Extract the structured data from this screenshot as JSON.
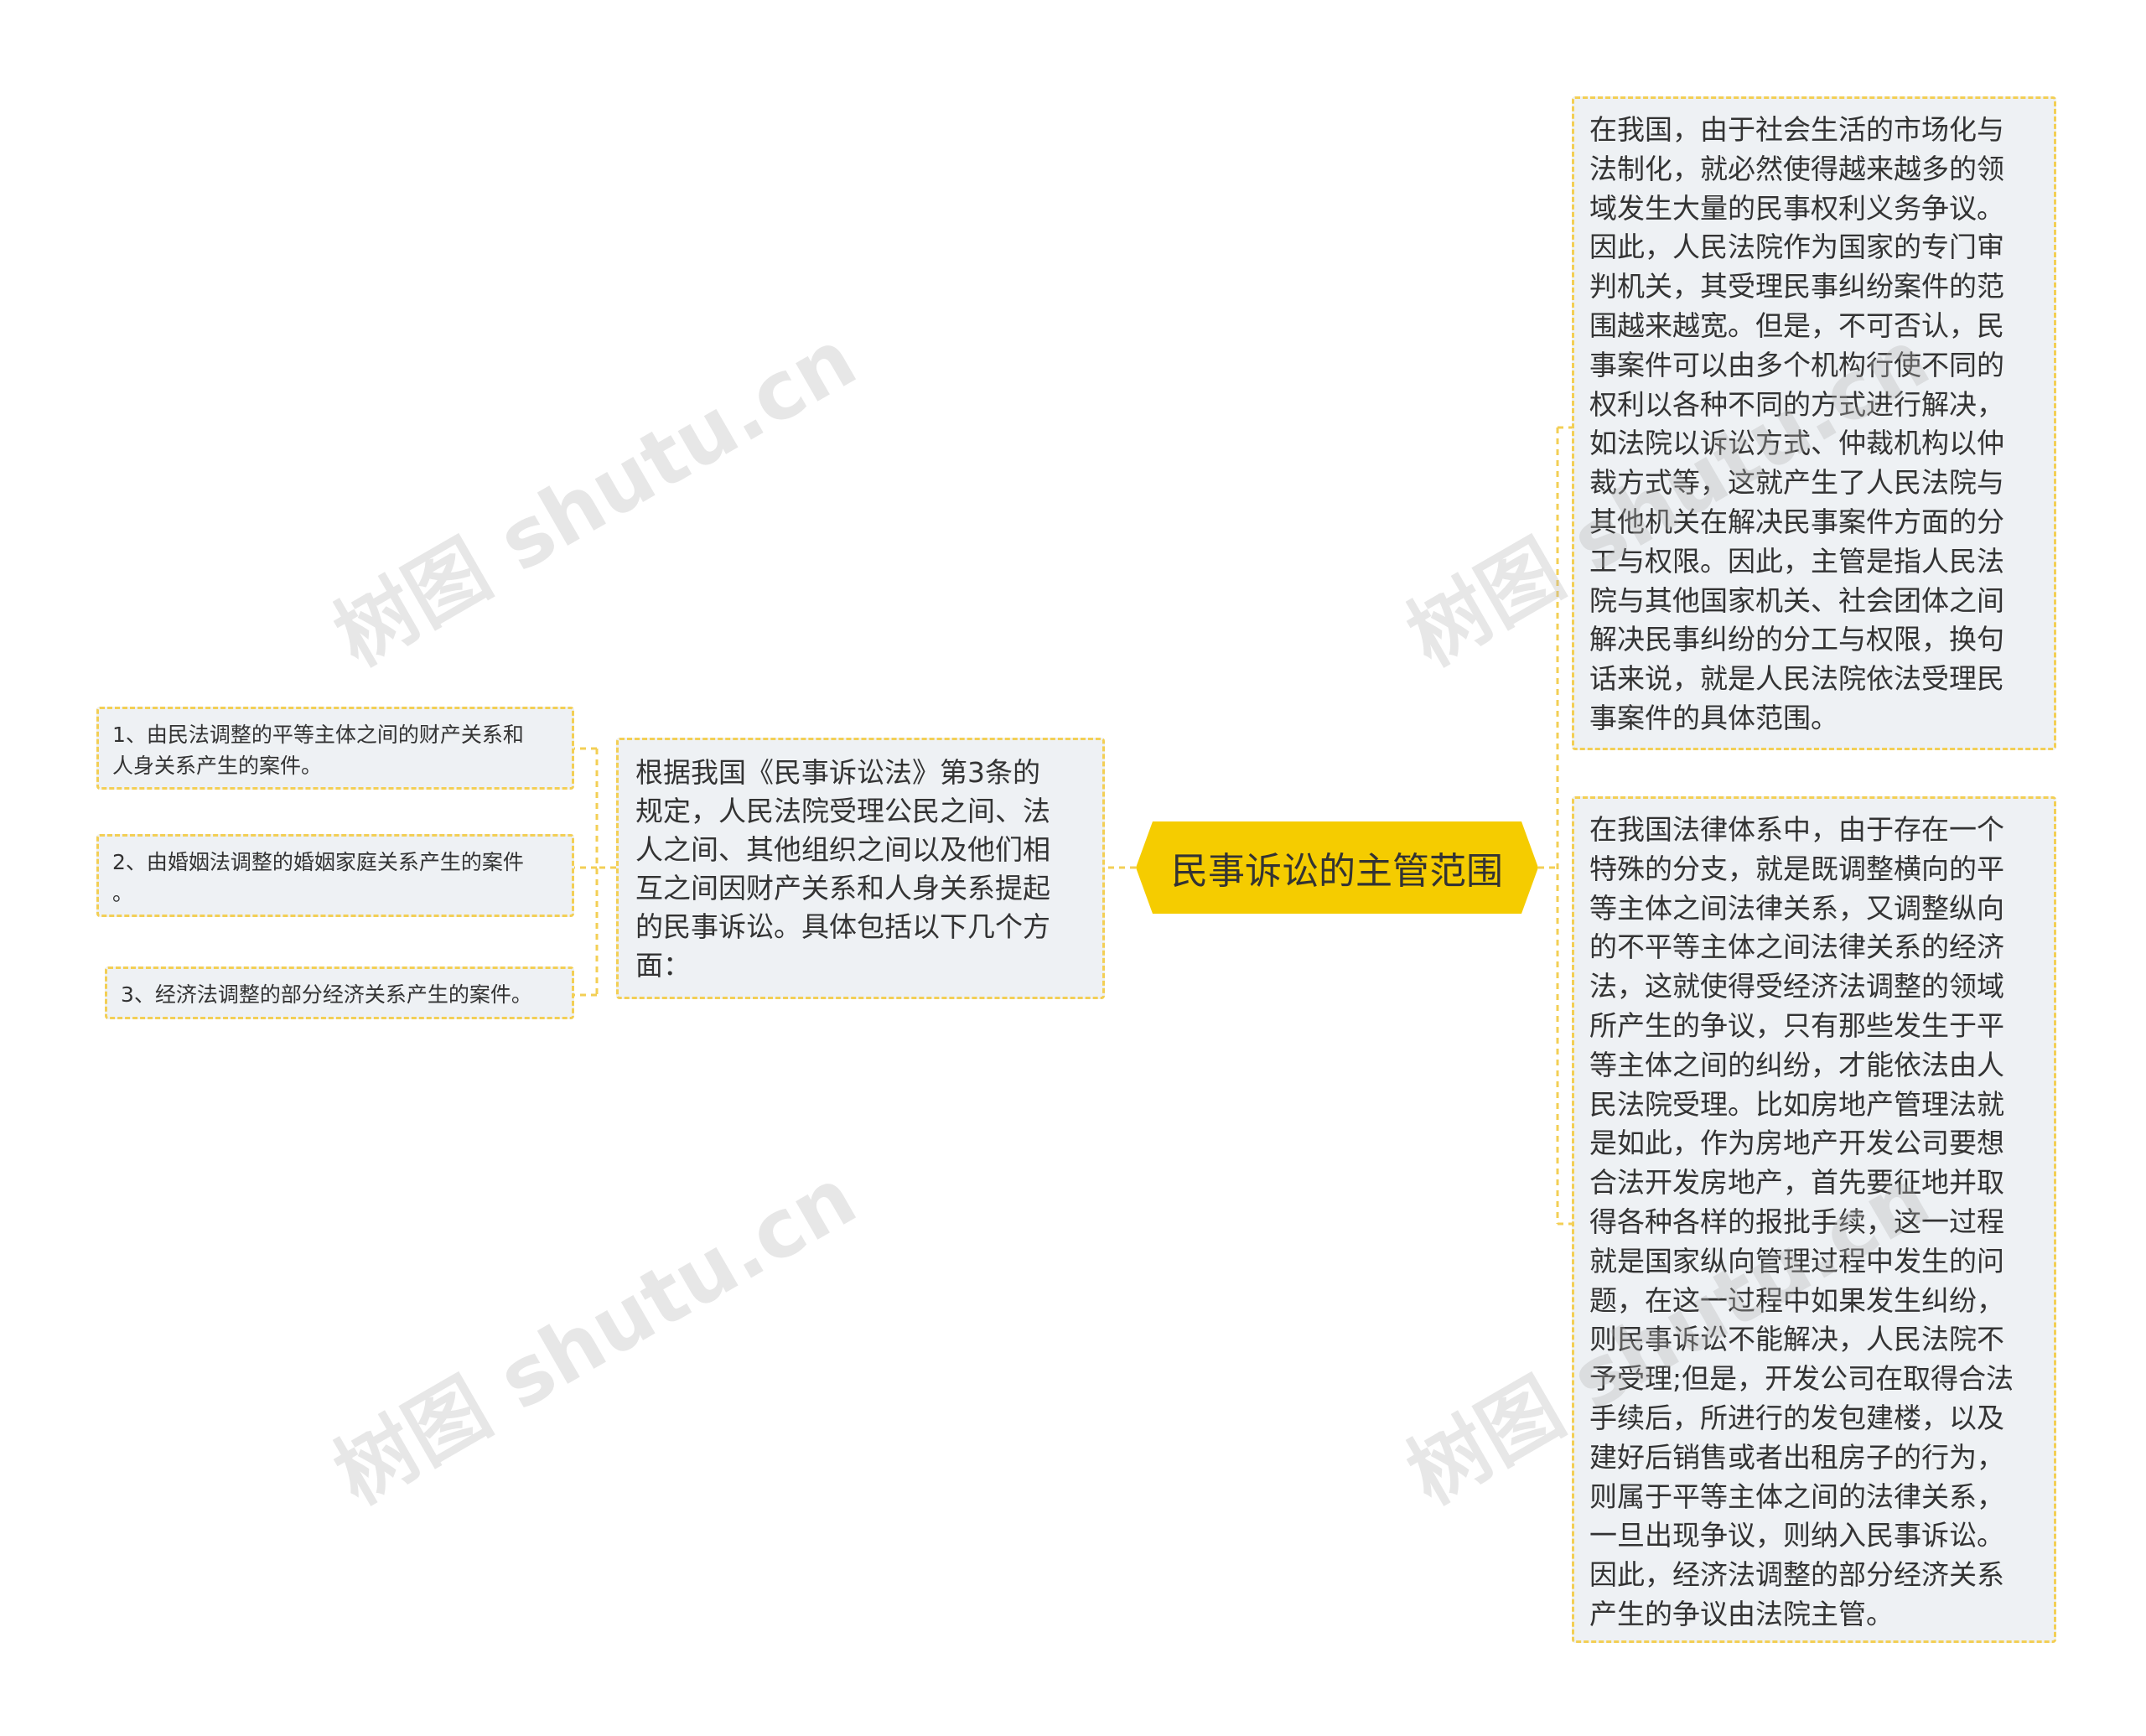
{
  "colors": {
    "root_fill": "#f5cc00",
    "connector": "#f3cf55",
    "node_fill": "#eef1f4",
    "text": "#333333"
  },
  "root": {
    "label": "民事诉讼的主管范围"
  },
  "left_branch": {
    "text": "根据我国《民事诉讼法》第3条的\n规定，人民法院受理公民之间、法\n人之间、其他组织之间以及他们相\n互之间因财产关系和人身关系提起\n的民事诉讼。具体包括以下几个方\n面：",
    "items": [
      {
        "text": "1、由民法调整的平等主体之间的财产关系和\n人身关系产生的案件。"
      },
      {
        "text": "2、由婚姻法调整的婚姻家庭关系产生的案件\n。"
      },
      {
        "text": "3、经济法调整的部分经济关系产生的案件。"
      }
    ]
  },
  "right_branches": [
    {
      "text": "在我国，由于社会生活的市场化与\n法制化，就必然使得越来越多的领\n域发生大量的民事权利义务争议。\n因此，人民法院作为国家的专门审\n判机关，其受理民事纠纷案件的范\n围越来越宽。但是，不可否认，民\n事案件可以由多个机构行使不同的\n权利以各种不同的方式进行解决，\n如法院以诉讼方式、仲裁机构以仲\n裁方式等，这就产生了人民法院与\n其他机关在解决民事案件方面的分\n工与权限。因此，主管是指人民法\n院与其他国家机关、社会团体之间\n解决民事纠纷的分工与权限，换句\n话来说，就是人民法院依法受理民\n事案件的具体范围。"
    },
    {
      "text": "在我国法律体系中，由于存在一个\n特殊的分支，就是既调整横向的平\n等主体之间法律关系，又调整纵向\n的不平等主体之间法律关系的经济\n法，这就使得受经济法调整的领域\n所产生的争议，只有那些发生于平\n等主体之间的纠纷，才能依法由人\n民法院受理。比如房地产管理法就\n是如此，作为房地产开发公司要想\n合法开发房地产，首先要征地并取\n得各种各样的报批手续，这一过程\n就是国家纵向管理过程中发生的问\n题，在这一过程中如果发生纠纷，\n则民事诉讼不能解决，人民法院不\n予受理;但是，开发公司在取得合法\n手续后，所进行的发包建楼，以及\n建好后销售或者出租房子的行为，\n则属于平等主体之间的法律关系，\n一旦出现争议，则纳入民事诉讼。\n因此，经济法调整的部分经济关系\n产生的争议由法院主管。"
    }
  ],
  "watermark": "树图 shutu.cn"
}
